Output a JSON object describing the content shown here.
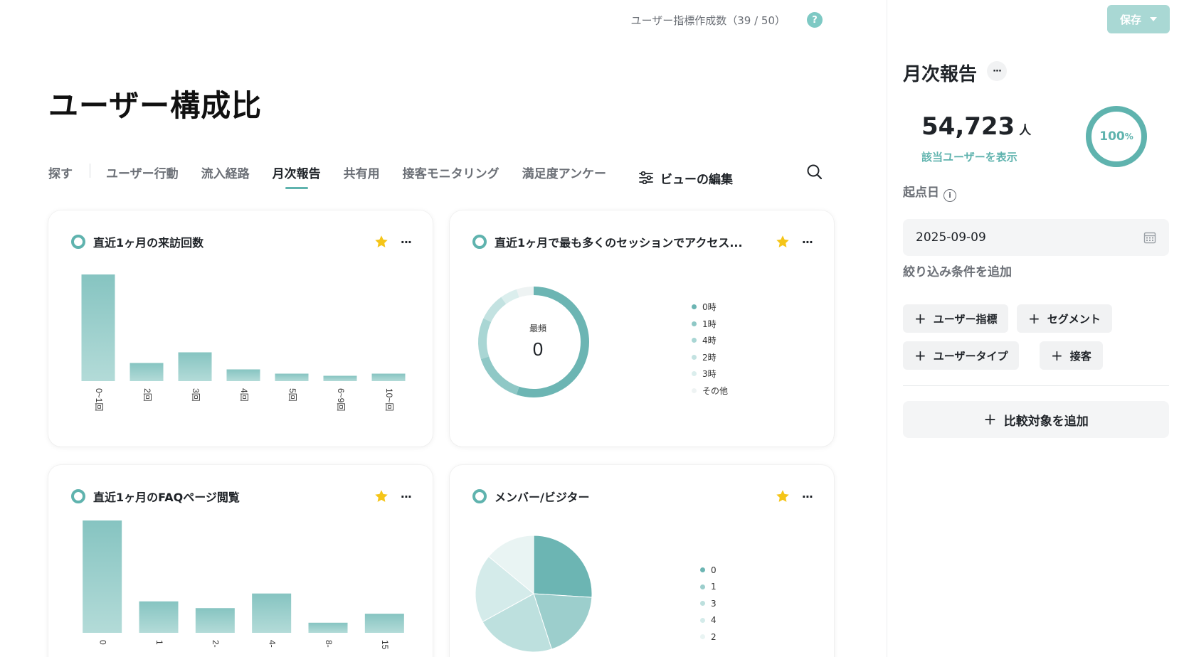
{
  "header": {
    "quota_text": "ユーザー指標作成数（39 / 50）",
    "help_icon": "question-circle-icon"
  },
  "page_title": "ユーザー構成比",
  "tabs": [
    {
      "label": "探す",
      "active": false
    },
    {
      "label": "ユーザー行動",
      "active": false
    },
    {
      "label": "流入経路",
      "active": false
    },
    {
      "label": "月次報告",
      "active": true
    },
    {
      "label": "共有用",
      "active": false
    },
    {
      "label": "接客モニタリング",
      "active": false
    },
    {
      "label": "満足度アンケー",
      "active": false
    }
  ],
  "edit_view_label": "ビューの編集",
  "cards": [
    {
      "title": "直近1ヶ月の来訪回数"
    },
    {
      "title": "直近1ヶ月で最も多くのセッションでアクセス...",
      "center_label": "最頻",
      "center_value": "0"
    },
    {
      "title": "直近1ヶ月のFAQページ閲覧"
    },
    {
      "title": "メンバー/ビジター"
    }
  ],
  "colors": {
    "accent": "#5fb3ae",
    "star": "#f5c518",
    "save_disabled": "#a9d8d4"
  },
  "chart_data": [
    {
      "type": "bar",
      "title": "直近1ヶ月の来訪回数",
      "categories": [
        "0~1回",
        "2回",
        "3回",
        "4回",
        "5回",
        "6~9回",
        "10~回"
      ],
      "values": [
        100,
        17,
        27,
        11,
        7,
        5,
        7
      ],
      "ylim": [
        0,
        100
      ]
    },
    {
      "type": "pie",
      "donut": true,
      "title": "直近1ヶ月で最も多くのセッションでアクセス...",
      "labels": [
        "0時",
        "1時",
        "4時",
        "2時",
        "3時",
        "その他"
      ],
      "values": [
        55,
        15,
        12,
        8,
        5,
        5
      ],
      "colors": [
        "#6cb5b3",
        "#8fc8c6",
        "#a9d6d4",
        "#c3e2e1",
        "#dbeeed",
        "#eef3f3"
      ]
    },
    {
      "type": "bar",
      "title": "直近1ヶ月のFAQページ閲覧",
      "categories": [
        "0",
        "1",
        "2-",
        "4-",
        "8-",
        "15"
      ],
      "values": [
        100,
        28,
        22,
        35,
        9,
        17
      ],
      "ylim": [
        0,
        100
      ]
    },
    {
      "type": "pie",
      "title": "メンバー/ビジター",
      "labels": [
        "0",
        "1",
        "3",
        "4",
        "2"
      ],
      "values": [
        26,
        19,
        22,
        19,
        14
      ],
      "colors": [
        "#6cb5b3",
        "#9ccecc",
        "#bde0de",
        "#d4ebea",
        "#e9f4f3"
      ]
    }
  ],
  "panel": {
    "save_label": "保存",
    "title": "月次報告",
    "user_count": "54,723",
    "user_unit": "人",
    "show_users_link": "該当ユーザーを表示",
    "percent_value": "100",
    "percent_sign": "%",
    "percent_fraction": 1.0,
    "start_date_label": "起点日",
    "start_date_value": "2025-09-09",
    "filter_label": "絞り込み条件を追加",
    "filter_chips": [
      "ユーザー指標",
      "セグメント",
      "ユーザータイプ",
      "接客"
    ],
    "compare_label": "比較対象を追加"
  }
}
